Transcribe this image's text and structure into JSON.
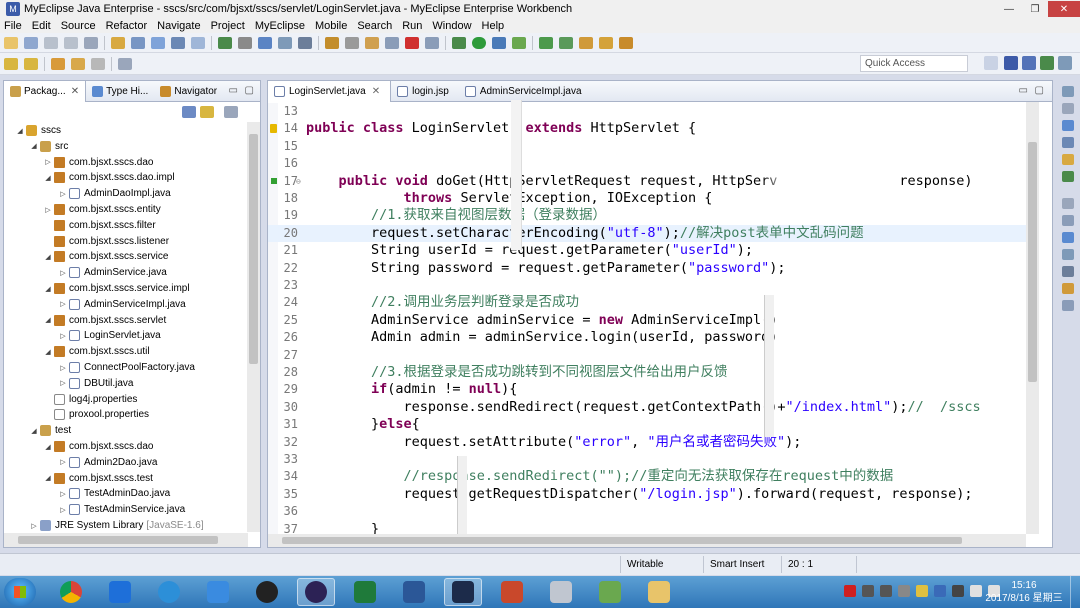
{
  "window": {
    "title": "MyEclipse Java Enterprise - sscs/src/com/bjsxt/sscs/servlet/LoginServlet.java - MyEclipse Enterprise Workbench",
    "minimize": "—",
    "maximize": "❐",
    "close": "✕"
  },
  "menu": [
    "File",
    "Edit",
    "Source",
    "Refactor",
    "Navigate",
    "Project",
    "MyEclipse",
    "Mobile",
    "Search",
    "Run",
    "Window",
    "Help"
  ],
  "quick_access": {
    "placeholder": "Quick Access"
  },
  "explorer": {
    "tabs": [
      {
        "label": "Packag...",
        "close": "✕"
      },
      {
        "label": "Type Hi..."
      },
      {
        "label": "Navigator"
      }
    ],
    "minimize": "▭",
    "maximize": "▢",
    "tree": [
      {
        "label": "sscs",
        "kind": "proj",
        "depth": 0,
        "twisty": "◢"
      },
      {
        "label": "src",
        "kind": "src",
        "depth": 1,
        "twisty": "◢"
      },
      {
        "label": "com.bjsxt.sscs.dao",
        "kind": "pkg",
        "depth": 2,
        "twisty": "▷"
      },
      {
        "label": "com.bjsxt.sscs.dao.impl",
        "kind": "pkg",
        "depth": 2,
        "twisty": "◢"
      },
      {
        "label": "AdminDaoImpl.java",
        "kind": "java",
        "depth": 3,
        "twisty": "▷"
      },
      {
        "label": "com.bjsxt.sscs.entity",
        "kind": "pkg",
        "depth": 2,
        "twisty": "▷"
      },
      {
        "label": "com.bjsxt.sscs.filter",
        "kind": "pkg",
        "depth": 2,
        "twisty": ""
      },
      {
        "label": "com.bjsxt.sscs.listener",
        "kind": "pkg",
        "depth": 2,
        "twisty": ""
      },
      {
        "label": "com.bjsxt.sscs.service",
        "kind": "pkg",
        "depth": 2,
        "twisty": "◢"
      },
      {
        "label": "AdminService.java",
        "kind": "java",
        "depth": 3,
        "twisty": "▷"
      },
      {
        "label": "com.bjsxt.sscs.service.impl",
        "kind": "pkg",
        "depth": 2,
        "twisty": "◢"
      },
      {
        "label": "AdminServiceImpl.java",
        "kind": "java",
        "depth": 3,
        "twisty": "▷"
      },
      {
        "label": "com.bjsxt.sscs.servlet",
        "kind": "pkg",
        "depth": 2,
        "twisty": "◢"
      },
      {
        "label": "LoginServlet.java",
        "kind": "java",
        "depth": 3,
        "twisty": "▷"
      },
      {
        "label": "com.bjsxt.sscs.util",
        "kind": "pkg",
        "depth": 2,
        "twisty": "◢"
      },
      {
        "label": "ConnectPoolFactory.java",
        "kind": "java",
        "depth": 3,
        "twisty": "▷"
      },
      {
        "label": "DBUtil.java",
        "kind": "java",
        "depth": 3,
        "twisty": "▷"
      },
      {
        "label": "log4j.properties",
        "kind": "file",
        "depth": 2,
        "twisty": ""
      },
      {
        "label": "proxool.properties",
        "kind": "file",
        "depth": 2,
        "twisty": ""
      },
      {
        "label": "test",
        "kind": "src",
        "depth": 1,
        "twisty": "◢"
      },
      {
        "label": "com.bjsxt.sscs.dao",
        "kind": "pkg",
        "depth": 2,
        "twisty": "◢"
      },
      {
        "label": "Admin2Dao.java",
        "kind": "java",
        "depth": 3,
        "twisty": "▷"
      },
      {
        "label": "com.bjsxt.sscs.test",
        "kind": "pkg",
        "depth": 2,
        "twisty": "◢"
      },
      {
        "label": "TestAdminDao.java",
        "kind": "java",
        "depth": 3,
        "twisty": "▷"
      },
      {
        "label": "TestAdminService.java",
        "kind": "java",
        "depth": 3,
        "twisty": "▷"
      },
      {
        "label": "JRE System Library",
        "kind": "lib",
        "depth": 1,
        "twisty": "▷",
        "suffix": "[JavaSE-1.6]"
      }
    ]
  },
  "editor": {
    "tabs": [
      {
        "label": "LoginServlet.java",
        "close": "✕"
      },
      {
        "label": "login.jsp"
      },
      {
        "label": "AdminServiceImpl.java"
      }
    ],
    "minimize": "▭",
    "maximize": "▢",
    "lines": [
      {
        "n": "13",
        "segs": [
          [
            "",
            ""
          ]
        ]
      },
      {
        "n": "14",
        "marker": "warn",
        "segs": [
          [
            "kw",
            "public class "
          ],
          [
            "",
            "LoginServlet  "
          ],
          [
            "kw",
            "extends "
          ],
          [
            "",
            "HttpServlet {"
          ]
        ]
      },
      {
        "n": "15",
        "segs": [
          [
            "",
            ""
          ]
        ]
      },
      {
        "n": "16",
        "segs": [
          [
            "",
            ""
          ]
        ]
      },
      {
        "n": "17",
        "marker": "ovr",
        "fold": "⊖",
        "segs": [
          [
            "",
            "    "
          ],
          [
            "kw",
            "public void "
          ],
          [
            "",
            "doGet(HttpServletRequest request, HttpServ"
          ],
          [
            "",
            "               response)"
          ]
        ]
      },
      {
        "n": "18",
        "segs": [
          [
            "",
            "            "
          ],
          [
            "kw",
            "throws "
          ],
          [
            "",
            "ServletException, IOException {"
          ]
        ]
      },
      {
        "n": "19",
        "segs": [
          [
            "",
            "        "
          ],
          [
            "cm",
            "//1.获取来自视图层数据（登录数据）"
          ]
        ]
      },
      {
        "n": "20",
        "marker": "brk",
        "hl": true,
        "segs": [
          [
            "",
            "        request.setCharacterEncoding("
          ],
          [
            "str",
            "\"utf-8\""
          ],
          [
            "",
            ");"
          ],
          [
            "cm",
            "//解决post表单中文乱码问题"
          ]
        ]
      },
      {
        "n": "21",
        "segs": [
          [
            "",
            "        String userId = request.getParameter("
          ],
          [
            "str",
            "\"userId\""
          ],
          [
            "",
            ");"
          ]
        ]
      },
      {
        "n": "22",
        "segs": [
          [
            "",
            "        String password = request.getParameter("
          ],
          [
            "str",
            "\"password\""
          ],
          [
            "",
            ");"
          ]
        ]
      },
      {
        "n": "23",
        "segs": [
          [
            "",
            ""
          ]
        ]
      },
      {
        "n": "24",
        "segs": [
          [
            "",
            "        "
          ],
          [
            "cm",
            "//2.调用业务层判断登录是否成功"
          ]
        ]
      },
      {
        "n": "25",
        "segs": [
          [
            "",
            "        AdminService adminService = "
          ],
          [
            "kw",
            "new "
          ],
          [
            "",
            "AdminServiceImpl()"
          ]
        ]
      },
      {
        "n": "26",
        "segs": [
          [
            "",
            "        Admin admin = adminService.login(userId, password)"
          ]
        ]
      },
      {
        "n": "27",
        "segs": [
          [
            "",
            ""
          ]
        ]
      },
      {
        "n": "28",
        "segs": [
          [
            "",
            "        "
          ],
          [
            "cm",
            "//3.根据登录是否成功跳转到不同视图层文件给出用户反馈"
          ]
        ]
      },
      {
        "n": "29",
        "segs": [
          [
            "",
            "        "
          ],
          [
            "kw",
            "if"
          ],
          [
            "",
            "(admin != "
          ],
          [
            "kw",
            "null"
          ],
          [
            "",
            "){"
          ]
        ]
      },
      {
        "n": "30",
        "segs": [
          [
            "",
            "            response.sendRedirect(request.getContextPath()+"
          ],
          [
            "str",
            "\"/index.html\""
          ],
          [
            "",
            ");"
          ],
          [
            "cm",
            "//  /sscs"
          ]
        ]
      },
      {
        "n": "31",
        "segs": [
          [
            "",
            "        }"
          ],
          [
            "kw",
            "else"
          ],
          [
            "",
            "{"
          ]
        ]
      },
      {
        "n": "32",
        "segs": [
          [
            "",
            "            request.setAttribute("
          ],
          [
            "str",
            "\"error\""
          ],
          [
            "",
            ", "
          ],
          [
            "str",
            "\"用户名或者密码失败\""
          ],
          [
            "",
            ");"
          ]
        ]
      },
      {
        "n": "33",
        "segs": [
          [
            "",
            ""
          ]
        ]
      },
      {
        "n": "34",
        "segs": [
          [
            "",
            "            "
          ],
          [
            "cm",
            "//response.sendRedirect(\"\");//重定向无法获取保存在request中的数据"
          ]
        ]
      },
      {
        "n": "35",
        "segs": [
          [
            "",
            "            request.getRequestDispatcher("
          ],
          [
            "str",
            "\"/login.jsp\""
          ],
          [
            "",
            ").forward(request, response);"
          ]
        ]
      },
      {
        "n": "36",
        "segs": [
          [
            "",
            ""
          ]
        ]
      },
      {
        "n": "37",
        "segs": [
          [
            "",
            "        }"
          ]
        ]
      }
    ]
  },
  "status": {
    "mode": "Writable",
    "insert": "Smart Insert",
    "position": "20 : 1"
  },
  "taskbar": {
    "time": "15:16",
    "date": "2017/8/16 星期三"
  },
  "colors": {
    "keyword": "#7f0055",
    "string": "#2a00ff",
    "comment": "#3f7f5f",
    "highlight": "#e8f2fe",
    "taskbar": "#3a80c0"
  }
}
